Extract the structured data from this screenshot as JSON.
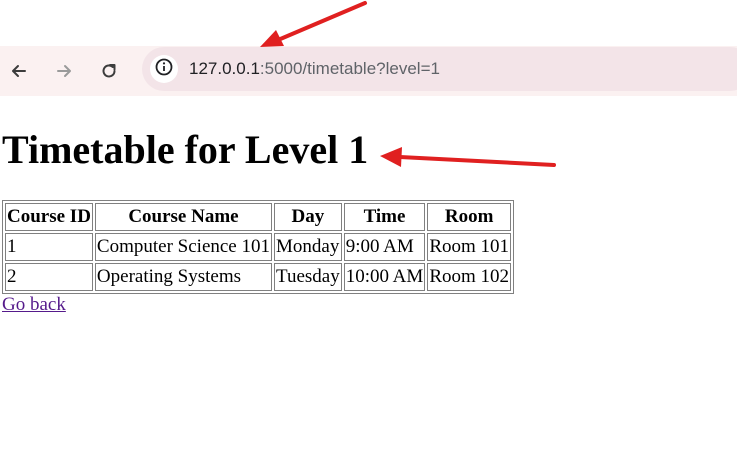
{
  "browser": {
    "url_host": "127.0.0.1",
    "url_rest": ":5000/timetable?level=1",
    "back_icon": "arrow-left-icon",
    "forward_icon": "arrow-right-icon",
    "reload_icon": "reload-icon",
    "site_info_icon": "info-icon"
  },
  "page": {
    "title": "Timetable for Level 1",
    "table": {
      "headers": [
        "Course ID",
        "Course Name",
        "Day",
        "Time",
        "Room"
      ],
      "rows": [
        [
          "1",
          "Computer Science 101",
          "Monday",
          "9:00 AM",
          "Room 101"
        ],
        [
          "2",
          "Operating Systems",
          "Tuesday",
          "10:00 AM",
          "Room 102"
        ]
      ]
    },
    "back_link": "Go back"
  },
  "colors": {
    "annotation_arrow": "#e02020",
    "link_visited": "#551a8b",
    "toolbar_bg": "#fbf1f1",
    "address_bg": "#f3e4e8"
  }
}
